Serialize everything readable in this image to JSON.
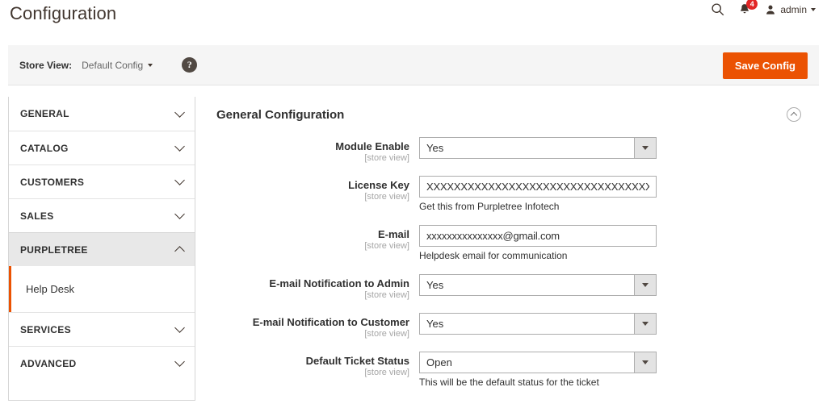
{
  "header": {
    "title": "Configuration",
    "search_icon": "search-icon",
    "notifications": {
      "icon": "bell-icon",
      "count": "4"
    },
    "account": {
      "icon": "user-icon",
      "label": "admin",
      "caret": "caret-down-icon"
    }
  },
  "storeview": {
    "label": "Store View:",
    "selected": "Default Config",
    "help_icon": "?",
    "save_label": "Save Config",
    "accent_color": "#eb5202"
  },
  "sidebar": {
    "items": [
      {
        "label": "GENERAL",
        "expanded": false
      },
      {
        "label": "CATALOG",
        "expanded": false
      },
      {
        "label": "CUSTOMERS",
        "expanded": false
      },
      {
        "label": "SALES",
        "expanded": false
      },
      {
        "label": "PURPLETREE",
        "expanded": true
      },
      {
        "label": "SERVICES",
        "expanded": false
      },
      {
        "label": "ADVANCED",
        "expanded": false
      }
    ],
    "subitems": [
      {
        "label": "Help Desk",
        "current": true
      }
    ]
  },
  "section": {
    "title": "General Configuration",
    "collapse_icon": "chevron-up-icon"
  },
  "fields": [
    {
      "label": "Module Enable",
      "scope": "[store view]",
      "type": "select",
      "value": "Yes",
      "note": ""
    },
    {
      "label": "License Key",
      "scope": "[store view]",
      "type": "text",
      "value": "XXXXXXXXXXXXXXXXXXXXXXXXXXXXXXXXXXXX",
      "note": "Get this from Purpletree Infotech"
    },
    {
      "label": "E-mail",
      "scope": "[store view]",
      "type": "text",
      "value": "xxxxxxxxxxxxxxx@gmail.com",
      "note": "Helpdesk email for communication"
    },
    {
      "label": "E-mail Notification to Admin",
      "scope": "[store view]",
      "type": "select",
      "value": "Yes",
      "note": ""
    },
    {
      "label": "E-mail Notification to Customer",
      "scope": "[store view]",
      "type": "select",
      "value": "Yes",
      "note": ""
    },
    {
      "label": "Default Ticket Status",
      "scope": "[store view]",
      "type": "select",
      "value": "Open",
      "note": "This will be the default status for the ticket"
    }
  ]
}
